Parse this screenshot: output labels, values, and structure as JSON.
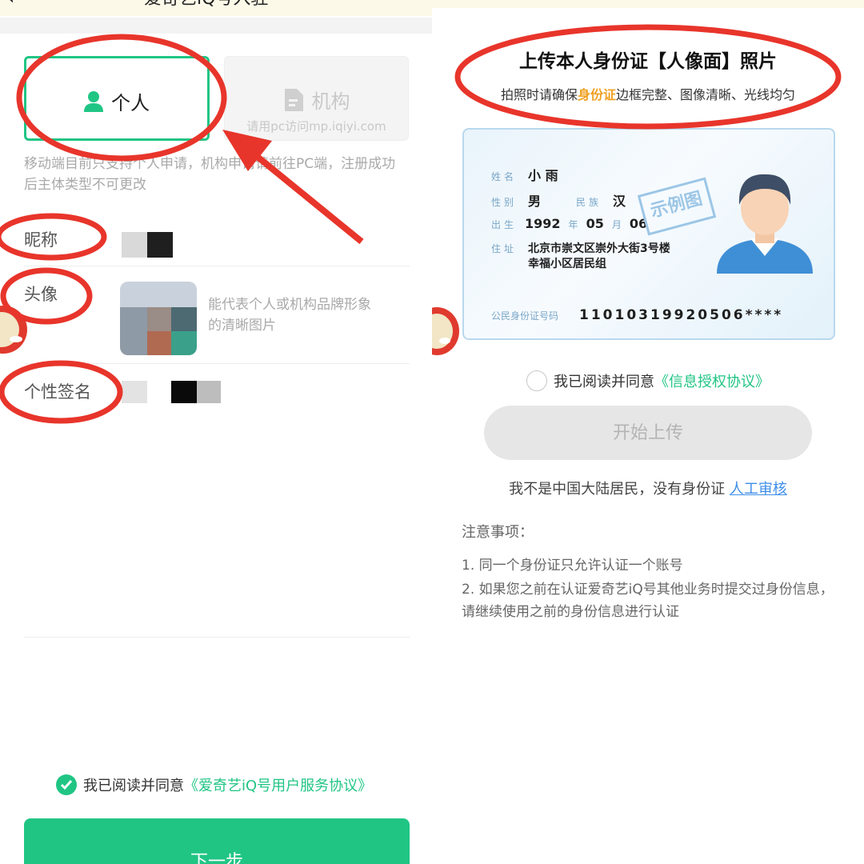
{
  "left": {
    "header": {
      "back_icon": "‹",
      "close_icon": "✕",
      "title": "爱奇艺iQ号入驻"
    },
    "type_cards": {
      "personal": {
        "label": "个人",
        "icon": "person-icon"
      },
      "organization": {
        "label": "机构",
        "hint": "请用pc访问mp.iqiyi.com",
        "icon": "document-icon"
      }
    },
    "notice": "移动端目前只支持个人申请，机构申请请前往PC端，注册成功后主体类型不可更改",
    "fields": {
      "nickname_label": "昵称",
      "avatar_label": "头像",
      "avatar_hint": "能代表个人或机构品牌形象的清晰图片",
      "signature_label": "个性签名"
    },
    "agreement": {
      "prefix": "我已阅读并同意",
      "link": "《爱奇艺iQ号用户服务协议》",
      "checked": true
    },
    "next_button": "下一步"
  },
  "right": {
    "title": "上传本人身份证【人像面】照片",
    "subtitle": {
      "before": "拍照时请确保",
      "highlight": "身份证",
      "after": "边框完整、图像清晰、光线均匀"
    },
    "sample_card": {
      "name_key": "姓名",
      "name": "小 雨",
      "gender_key": "性别",
      "gender": "男",
      "ethnicity_key": "民族",
      "ethnicity": "汉",
      "birth_key": "出生",
      "birth_year": "1992",
      "year_unit": "年",
      "birth_month": "05",
      "month_unit": "月",
      "birth_day": "06",
      "address_key": "住址",
      "address_line1": "北京市崇文区崇外大街3号楼",
      "address_line2": "幸福小区居民组",
      "id_key": "公民身份证号码",
      "id_number": "11010319920506****",
      "stamp": "示例图"
    },
    "agreement": {
      "prefix": "我已阅读并同意",
      "link": "《信息授权协议》",
      "checked": false
    },
    "upload_button": "开始上传",
    "no_id": {
      "text": "我不是中国大陆居民，没有身份证",
      "link": "人工审核"
    },
    "notes": {
      "title": "注意事项：",
      "items": [
        "1. 同一个身份证只允许认证一个账号",
        "2. 如果您之前在认证爱奇艺iQ号其他业务时提交过身份信息，请继续使用之前的身份信息进行认证"
      ]
    }
  },
  "colors": {
    "brand_green": "#20c584",
    "annotation_red": "#e8352b",
    "link_blue": "#3e8ee8",
    "highlight_orange": "#f0a020"
  }
}
